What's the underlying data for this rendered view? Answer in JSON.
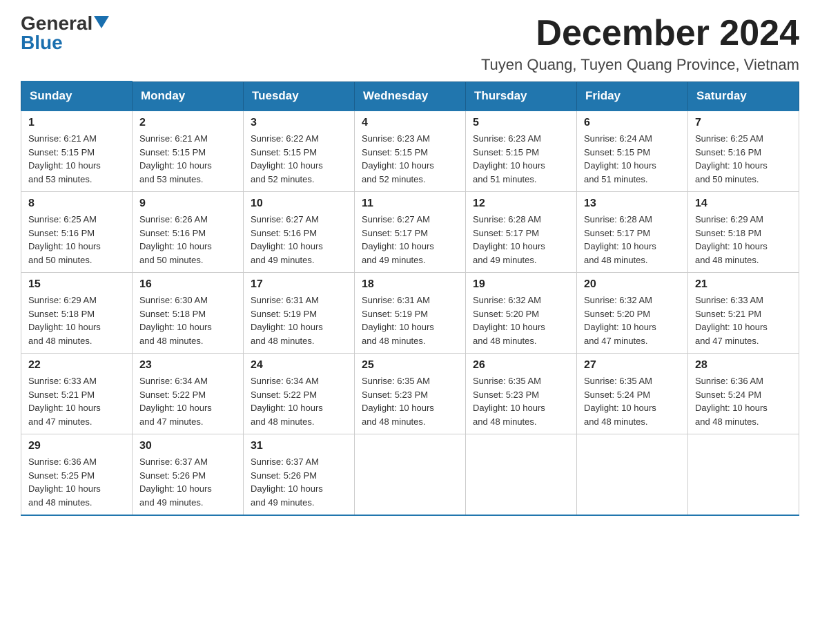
{
  "header": {
    "logo": {
      "general": "General",
      "blue": "Blue",
      "arrow": "▶"
    },
    "title": "December 2024",
    "location": "Tuyen Quang, Tuyen Quang Province, Vietnam"
  },
  "days_of_week": [
    "Sunday",
    "Monday",
    "Tuesday",
    "Wednesday",
    "Thursday",
    "Friday",
    "Saturday"
  ],
  "weeks": [
    [
      {
        "day": "1",
        "sunrise": "6:21 AM",
        "sunset": "5:15 PM",
        "daylight": "10 hours and 53 minutes."
      },
      {
        "day": "2",
        "sunrise": "6:21 AM",
        "sunset": "5:15 PM",
        "daylight": "10 hours and 53 minutes."
      },
      {
        "day": "3",
        "sunrise": "6:22 AM",
        "sunset": "5:15 PM",
        "daylight": "10 hours and 52 minutes."
      },
      {
        "day": "4",
        "sunrise": "6:23 AM",
        "sunset": "5:15 PM",
        "daylight": "10 hours and 52 minutes."
      },
      {
        "day": "5",
        "sunrise": "6:23 AM",
        "sunset": "5:15 PM",
        "daylight": "10 hours and 51 minutes."
      },
      {
        "day": "6",
        "sunrise": "6:24 AM",
        "sunset": "5:15 PM",
        "daylight": "10 hours and 51 minutes."
      },
      {
        "day": "7",
        "sunrise": "6:25 AM",
        "sunset": "5:16 PM",
        "daylight": "10 hours and 50 minutes."
      }
    ],
    [
      {
        "day": "8",
        "sunrise": "6:25 AM",
        "sunset": "5:16 PM",
        "daylight": "10 hours and 50 minutes."
      },
      {
        "day": "9",
        "sunrise": "6:26 AM",
        "sunset": "5:16 PM",
        "daylight": "10 hours and 50 minutes."
      },
      {
        "day": "10",
        "sunrise": "6:27 AM",
        "sunset": "5:16 PM",
        "daylight": "10 hours and 49 minutes."
      },
      {
        "day": "11",
        "sunrise": "6:27 AM",
        "sunset": "5:17 PM",
        "daylight": "10 hours and 49 minutes."
      },
      {
        "day": "12",
        "sunrise": "6:28 AM",
        "sunset": "5:17 PM",
        "daylight": "10 hours and 49 minutes."
      },
      {
        "day": "13",
        "sunrise": "6:28 AM",
        "sunset": "5:17 PM",
        "daylight": "10 hours and 48 minutes."
      },
      {
        "day": "14",
        "sunrise": "6:29 AM",
        "sunset": "5:18 PM",
        "daylight": "10 hours and 48 minutes."
      }
    ],
    [
      {
        "day": "15",
        "sunrise": "6:29 AM",
        "sunset": "5:18 PM",
        "daylight": "10 hours and 48 minutes."
      },
      {
        "day": "16",
        "sunrise": "6:30 AM",
        "sunset": "5:18 PM",
        "daylight": "10 hours and 48 minutes."
      },
      {
        "day": "17",
        "sunrise": "6:31 AM",
        "sunset": "5:19 PM",
        "daylight": "10 hours and 48 minutes."
      },
      {
        "day": "18",
        "sunrise": "6:31 AM",
        "sunset": "5:19 PM",
        "daylight": "10 hours and 48 minutes."
      },
      {
        "day": "19",
        "sunrise": "6:32 AM",
        "sunset": "5:20 PM",
        "daylight": "10 hours and 48 minutes."
      },
      {
        "day": "20",
        "sunrise": "6:32 AM",
        "sunset": "5:20 PM",
        "daylight": "10 hours and 47 minutes."
      },
      {
        "day": "21",
        "sunrise": "6:33 AM",
        "sunset": "5:21 PM",
        "daylight": "10 hours and 47 minutes."
      }
    ],
    [
      {
        "day": "22",
        "sunrise": "6:33 AM",
        "sunset": "5:21 PM",
        "daylight": "10 hours and 47 minutes."
      },
      {
        "day": "23",
        "sunrise": "6:34 AM",
        "sunset": "5:22 PM",
        "daylight": "10 hours and 47 minutes."
      },
      {
        "day": "24",
        "sunrise": "6:34 AM",
        "sunset": "5:22 PM",
        "daylight": "10 hours and 48 minutes."
      },
      {
        "day": "25",
        "sunrise": "6:35 AM",
        "sunset": "5:23 PM",
        "daylight": "10 hours and 48 minutes."
      },
      {
        "day": "26",
        "sunrise": "6:35 AM",
        "sunset": "5:23 PM",
        "daylight": "10 hours and 48 minutes."
      },
      {
        "day": "27",
        "sunrise": "6:35 AM",
        "sunset": "5:24 PM",
        "daylight": "10 hours and 48 minutes."
      },
      {
        "day": "28",
        "sunrise": "6:36 AM",
        "sunset": "5:24 PM",
        "daylight": "10 hours and 48 minutes."
      }
    ],
    [
      {
        "day": "29",
        "sunrise": "6:36 AM",
        "sunset": "5:25 PM",
        "daylight": "10 hours and 48 minutes."
      },
      {
        "day": "30",
        "sunrise": "6:37 AM",
        "sunset": "5:26 PM",
        "daylight": "10 hours and 49 minutes."
      },
      {
        "day": "31",
        "sunrise": "6:37 AM",
        "sunset": "5:26 PM",
        "daylight": "10 hours and 49 minutes."
      },
      null,
      null,
      null,
      null
    ]
  ],
  "labels": {
    "sunrise": "Sunrise:",
    "sunset": "Sunset:",
    "daylight": "Daylight:"
  }
}
